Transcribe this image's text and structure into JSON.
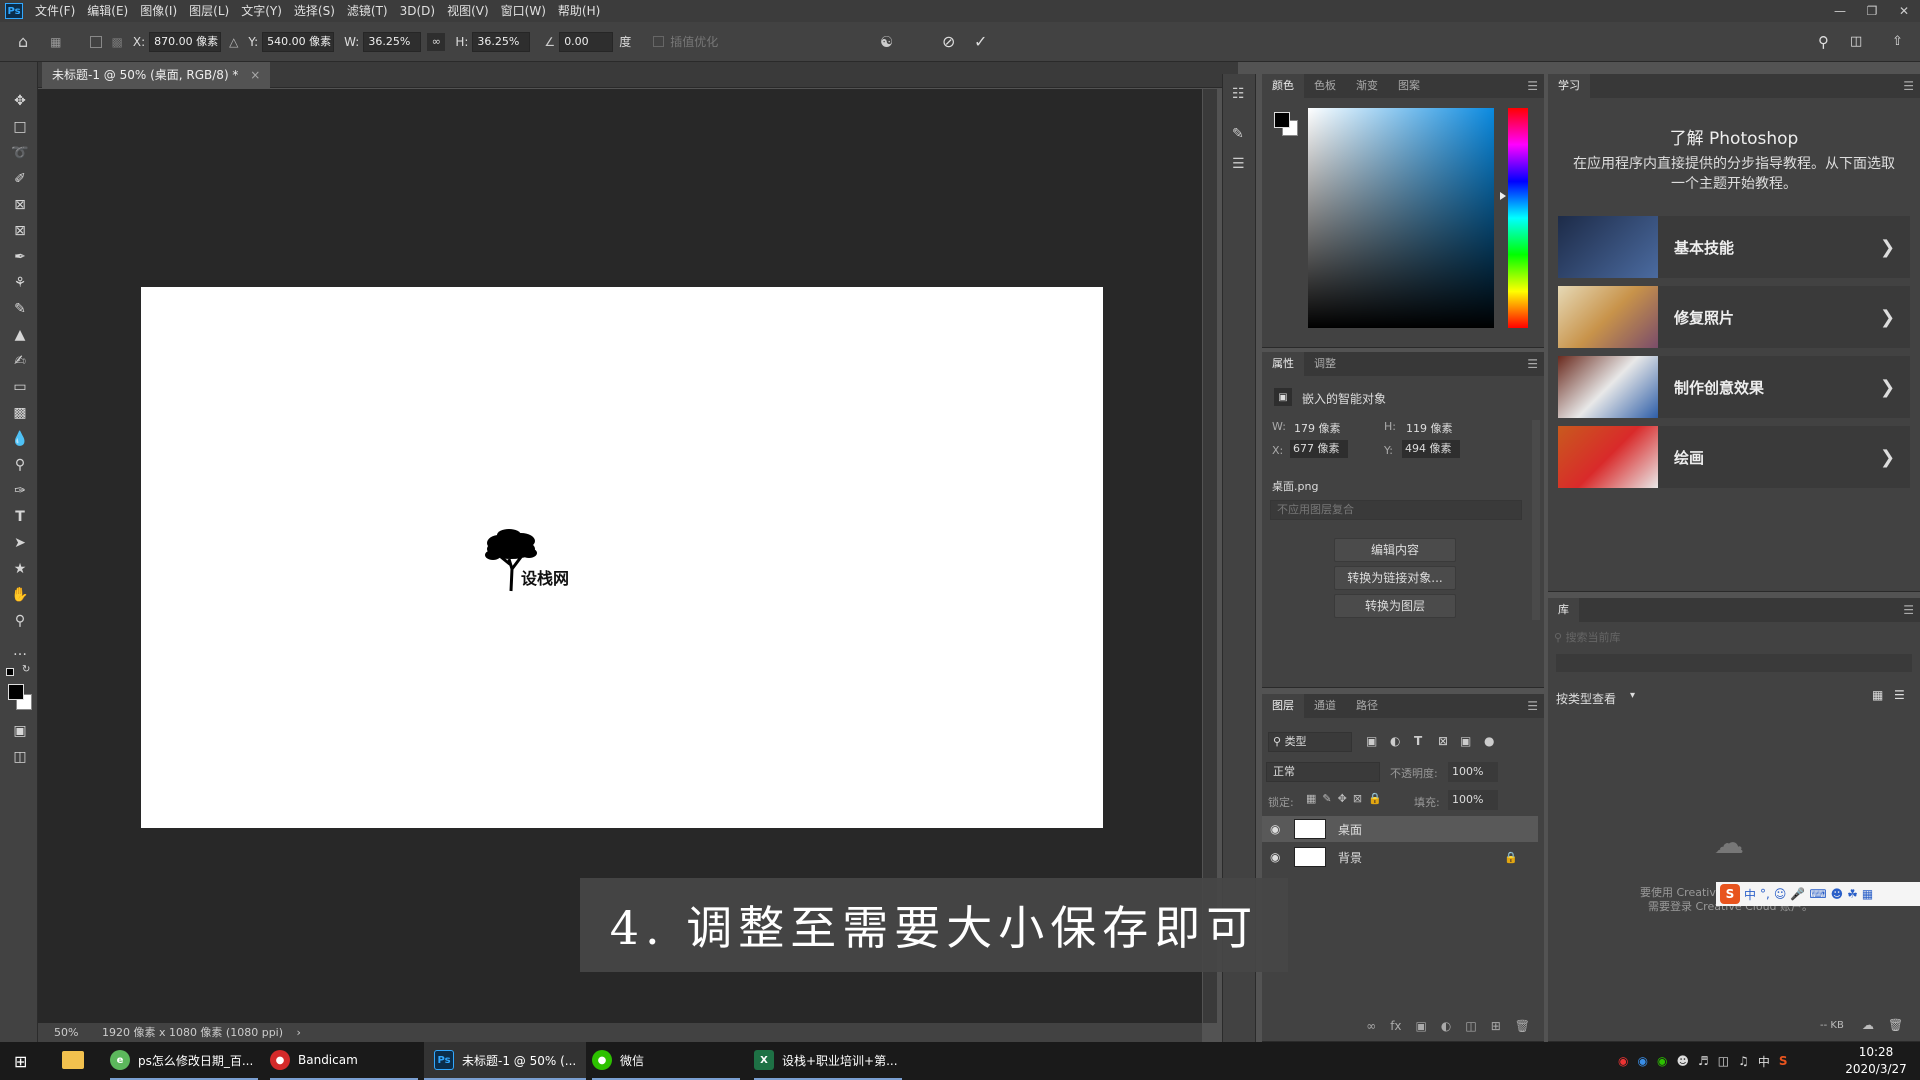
{
  "menubar": {
    "app_logo": "Ps",
    "items": [
      "文件(F)",
      "编辑(E)",
      "图像(I)",
      "图层(L)",
      "文字(Y)",
      "选择(S)",
      "滤镜(T)",
      "3D(D)",
      "视图(V)",
      "窗口(W)",
      "帮助(H)"
    ]
  },
  "options": {
    "x_label": "X:",
    "x_value": "870.00 像素",
    "y_label": "Y:",
    "y_value": "540.00 像素",
    "w_label": "W:",
    "w_value": "36.25%",
    "h_label": "H:",
    "h_value": "36.25%",
    "angle_value": "0.00",
    "angle_unit": "度",
    "interp_label": "插值优化"
  },
  "document": {
    "tab_title": "未标题-1 @ 50% (桌面, RGB/8) *",
    "logo_text": "设栈网"
  },
  "status": {
    "zoom": "50%",
    "doc_info": "1920 像素 x 1080 像素 (1080 ppi)"
  },
  "color_panel": {
    "tabs": [
      "颜色",
      "色板",
      "渐变",
      "图案"
    ]
  },
  "properties": {
    "tabs": [
      "属性",
      "调整"
    ],
    "type": "嵌入的智能对象",
    "w_label": "W:",
    "w_value": "179 像素",
    "h_label": "H:",
    "h_value": "119 像素",
    "x_label": "X:",
    "x_value": "677 像素",
    "y_label": "Y:",
    "y_value": "494 像素",
    "filename": "桌面.png",
    "comp_placeholder": "不应用图层复合",
    "btn_edit": "编辑内容",
    "btn_link": "转换为链接对象...",
    "btn_layer": "转换为图层"
  },
  "layers": {
    "tabs": [
      "图层",
      "通道",
      "路径"
    ],
    "filter_label": "类型",
    "blend_mode": "正常",
    "opacity_label": "不透明度:",
    "opacity_value": "100%",
    "lock_label": "锁定:",
    "fill_label": "填充:",
    "fill_value": "100%",
    "items": [
      {
        "name": "桌面"
      },
      {
        "name": "背景"
      }
    ]
  },
  "learn": {
    "tab": "学习",
    "title": "了解 Photoshop",
    "desc": "在应用程序内直接提供的分步指导教程。从下面选取一个主题开始教程。",
    "cards": [
      {
        "label": "基本技能"
      },
      {
        "label": "修复照片"
      },
      {
        "label": "制作创意效果"
      },
      {
        "label": "绘画"
      }
    ]
  },
  "library": {
    "tab": "库",
    "search_placeholder": "搜索当前库",
    "view_label": "按类型查看",
    "cloud_msg1": "要使用 Creative Cloud 库,",
    "cloud_msg2": "需要登录 Creative Cloud 账户。",
    "size": "-- KB"
  },
  "subtitle": "4. 调整至需要大小保存即可",
  "taskbar": {
    "items": [
      {
        "label": "ps怎么修改日期_百..."
      },
      {
        "label": "Bandicam"
      },
      {
        "label": "未标题-1 @ 50% (..."
      },
      {
        "label": "微信"
      },
      {
        "label": "设栈+职业培训+第..."
      }
    ],
    "ime": "中",
    "time": "10:28",
    "date": "2020/3/27"
  }
}
